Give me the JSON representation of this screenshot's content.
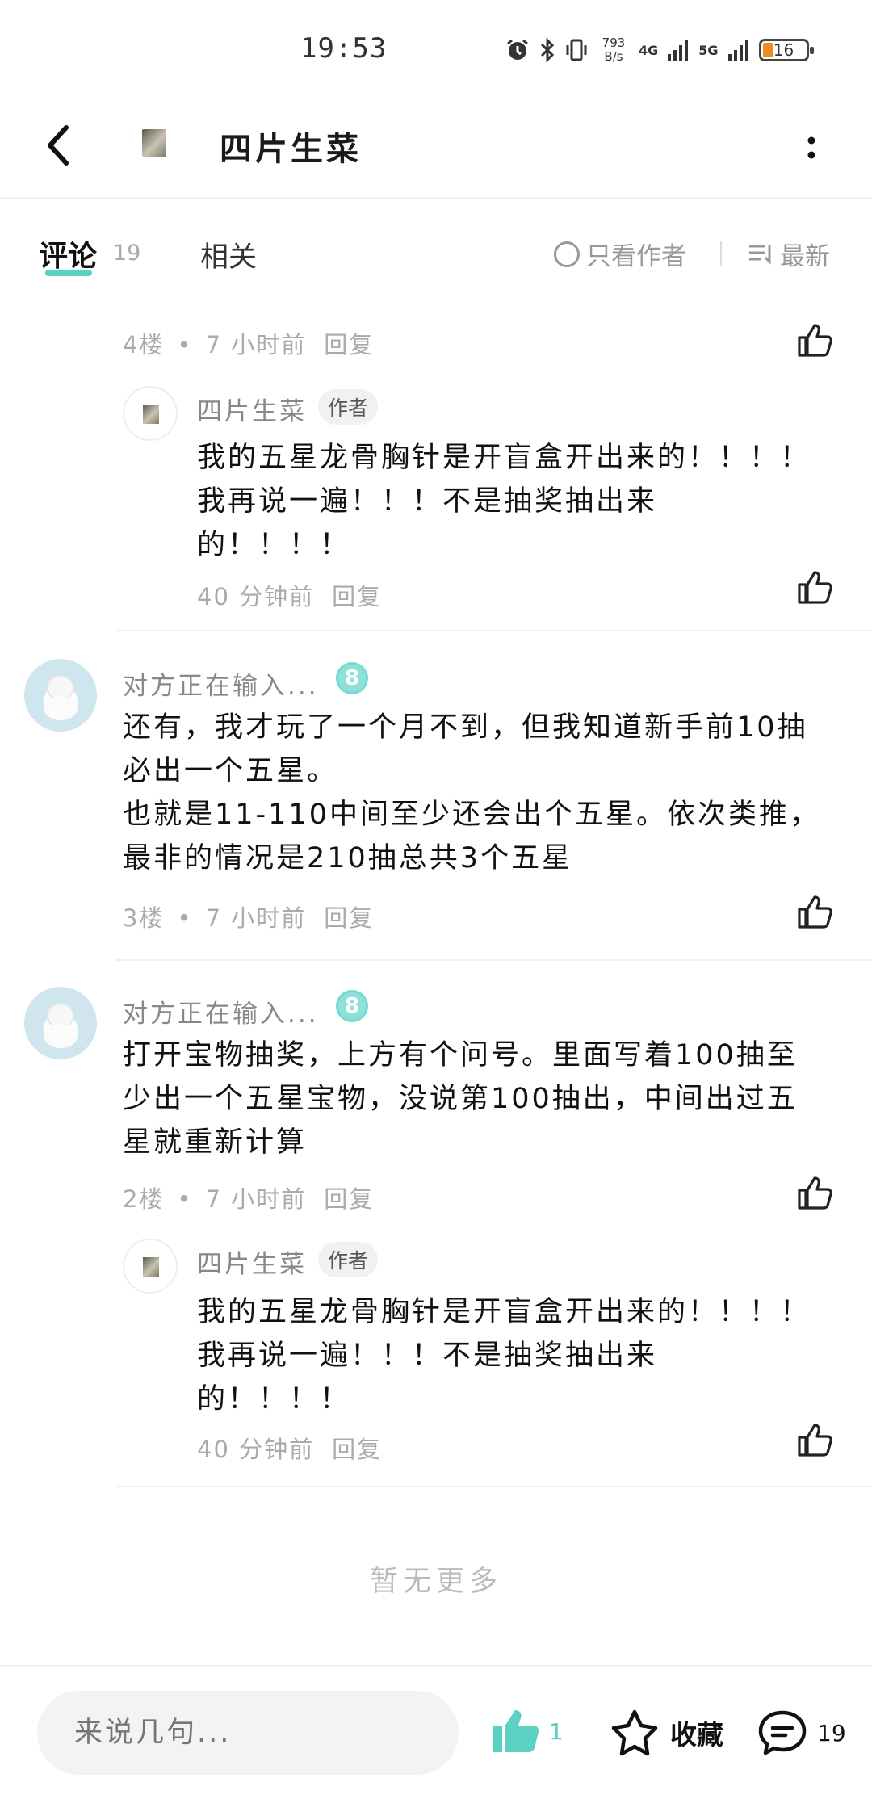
{
  "status_bar": {
    "time": "19:53",
    "net_speed_value": "793",
    "net_speed_unit": "B/s",
    "net1": "4G",
    "net2": "5G",
    "battery": "16"
  },
  "header": {
    "title": "四片生菜"
  },
  "tabs": {
    "comments_label": "评论",
    "comments_count": "19",
    "related_label": "相关",
    "author_only_label": "只看作者",
    "sort_label": "最新"
  },
  "comments": [
    {
      "floor": "4楼",
      "time": "7 小时前",
      "reply": "回复",
      "replies": [
        {
          "user": "四片生菜",
          "tag": "作者",
          "text": "我的五星龙骨胸针是开盲盒开出来的！！！！\n我再说一遍！！！不是抽奖抽出来\n的！！！！",
          "time": "40 分钟前",
          "reply": "回复"
        }
      ]
    },
    {
      "user": "对方正在输入...",
      "level": "8",
      "text": "还有，我才玩了一个月不到，但我知道新手前10抽\n必出一个五星。\n也就是11-110中间至少还会出个五星。依次类推，\n最非的情况是210抽总共3个五星",
      "floor": "3楼",
      "time": "7 小时前",
      "reply": "回复"
    },
    {
      "user": "对方正在输入...",
      "level": "8",
      "text": "打开宝物抽奖，上方有个问号。里面写着100抽至\n少出一个五星宝物，没说第100抽出，中间出过五\n星就重新计算",
      "floor": "2楼",
      "time": "7 小时前",
      "reply": "回复",
      "replies": [
        {
          "user": "四片生菜",
          "tag": "作者",
          "text": "我的五星龙骨胸针是开盲盒开出来的！！！！\n我再说一遍！！！不是抽奖抽出来\n的！！！！",
          "time": "40 分钟前",
          "reply": "回复"
        }
      ]
    }
  ],
  "no_more": "暂无更多",
  "bottom_bar": {
    "input_placeholder": "来说几句...",
    "like_count": "1",
    "favorite_label": "收藏",
    "comment_count": "19"
  },
  "colors": {
    "accent": "#5cd0c1",
    "muted": "#aaaaaa"
  }
}
